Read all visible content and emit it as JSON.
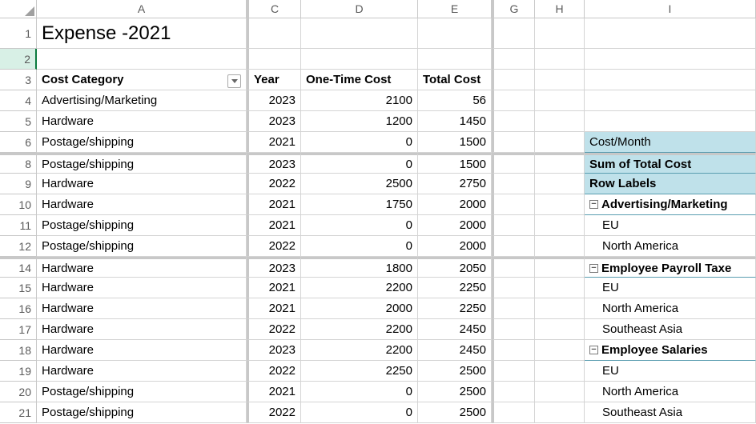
{
  "columns": [
    "A",
    "C",
    "D",
    "E",
    "G",
    "H",
    "I"
  ],
  "title": "Expense -2021",
  "headers": {
    "costCategory": "Cost Category",
    "year": "Year",
    "oneTime": "One-Time Cost",
    "total": "Total Cost"
  },
  "rows": [
    {
      "n": 4,
      "cat": "Advertising/Marketing",
      "year": 2023,
      "one": 2100,
      "tot": 56
    },
    {
      "n": 5,
      "cat": "Hardware",
      "year": 2023,
      "one": 1200,
      "tot": 1450
    },
    {
      "n": 6,
      "cat": "Postage/shipping",
      "year": 2021,
      "one": 0,
      "tot": 1500
    },
    {
      "n": 8,
      "cat": "Postage/shipping",
      "year": 2023,
      "one": 0,
      "tot": 1500
    },
    {
      "n": 9,
      "cat": "Hardware",
      "year": 2022,
      "one": 2500,
      "tot": 2750
    },
    {
      "n": 10,
      "cat": "Hardware",
      "year": 2021,
      "one": 1750,
      "tot": 2000
    },
    {
      "n": 11,
      "cat": "Postage/shipping",
      "year": 2021,
      "one": 0,
      "tot": 2000
    },
    {
      "n": 12,
      "cat": "Postage/shipping",
      "year": 2022,
      "one": 0,
      "tot": 2000
    },
    {
      "n": 14,
      "cat": "Hardware",
      "year": 2023,
      "one": 1800,
      "tot": 2050
    },
    {
      "n": 15,
      "cat": "Hardware",
      "year": 2021,
      "one": 2200,
      "tot": 2250
    },
    {
      "n": 16,
      "cat": "Hardware",
      "year": 2021,
      "one": 2000,
      "tot": 2250
    },
    {
      "n": 17,
      "cat": "Hardware",
      "year": 2022,
      "one": 2200,
      "tot": 2450
    },
    {
      "n": 18,
      "cat": "Hardware",
      "year": 2023,
      "one": 2200,
      "tot": 2450
    },
    {
      "n": 19,
      "cat": "Hardware",
      "year": 2022,
      "one": 2250,
      "tot": 2500
    },
    {
      "n": 20,
      "cat": "Postage/shipping",
      "year": 2021,
      "one": 0,
      "tot": 2500
    },
    {
      "n": 21,
      "cat": "Postage/shipping",
      "year": 2022,
      "one": 0,
      "tot": 2500
    }
  ],
  "pivot": {
    "head1": "Cost/Month",
    "head2": "Sum of Total Cost",
    "head3": "Row Labels",
    "groups": [
      {
        "label": "Advertising/Marketing",
        "items": [
          "EU",
          "North America"
        ],
        "row": 10
      },
      {
        "label": "Employee Payroll Taxe",
        "items": [
          "EU",
          "North America",
          "Southeast Asia"
        ],
        "row": 14
      },
      {
        "label": "Employee Salaries",
        "items": [
          "EU",
          "North America",
          "Southeast Asia"
        ],
        "row": 18
      }
    ]
  },
  "minus": "−"
}
